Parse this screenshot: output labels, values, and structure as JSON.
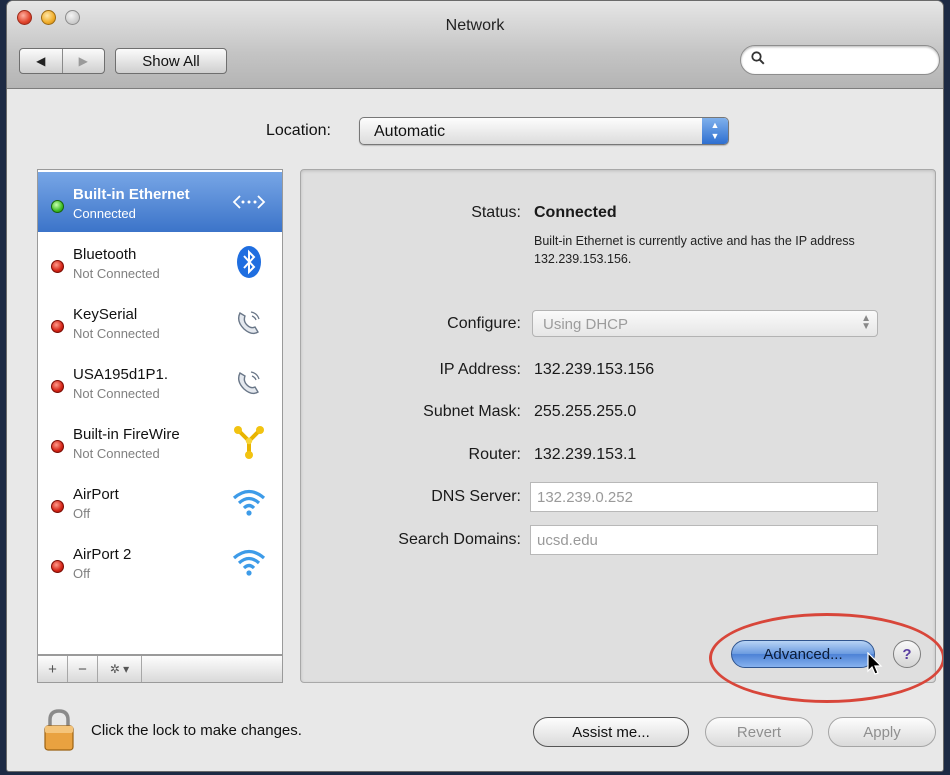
{
  "window": {
    "title": "Network"
  },
  "toolbar": {
    "back_icon": "◀",
    "forward_icon": "▶",
    "show_all_label": "Show All",
    "search_value": ""
  },
  "location": {
    "label": "Location:",
    "value": "Automatic"
  },
  "services": [
    {
      "name": "Built-in Ethernet",
      "status": "Connected",
      "icon": "ethernet-icon",
      "state": "connected",
      "selected": true
    },
    {
      "name": "Bluetooth",
      "status": "Not Connected",
      "icon": "bluetooth-icon",
      "state": "not-connected",
      "selected": false
    },
    {
      "name": "KeySerial",
      "status": "Not Connected",
      "icon": "modem-phone-icon",
      "state": "not-connected",
      "selected": false
    },
    {
      "name": "USA195d1P1.",
      "status": "Not Connected",
      "icon": "modem-phone-icon",
      "state": "not-connected",
      "selected": false
    },
    {
      "name": "Built-in FireWire",
      "status": "Not Connected",
      "icon": "firewire-icon",
      "state": "not-connected",
      "selected": false
    },
    {
      "name": "AirPort",
      "status": "Off",
      "icon": "wifi-icon",
      "state": "off",
      "selected": false
    },
    {
      "name": "AirPort 2",
      "status": "Off",
      "icon": "wifi-icon",
      "state": "off",
      "selected": false
    }
  ],
  "sidebar_controls": {
    "add": "+",
    "remove": "−",
    "action": "✲ ▾"
  },
  "detail": {
    "status_label": "Status:",
    "status_value": "Connected",
    "status_description": "Built-in Ethernet is currently active and has the IP address 132.239.153.156.",
    "configure_label": "Configure:",
    "configure_value": "Using DHCP",
    "ip_label": "IP Address:",
    "ip_value": "132.239.153.156",
    "subnet_label": "Subnet Mask:",
    "subnet_value": "255.255.255.0",
    "router_label": "Router:",
    "router_value": "132.239.153.1",
    "dns_label": "DNS Server:",
    "dns_placeholder": "132.239.0.252",
    "search_domains_label": "Search Domains:",
    "search_domains_placeholder": "ucsd.edu",
    "advanced_label": "Advanced...",
    "help_label": "?"
  },
  "footer": {
    "lock_text": "Click the lock to make changes.",
    "assist_label": "Assist me...",
    "revert_label": "Revert",
    "apply_label": "Apply"
  },
  "colors": {
    "selection_blue": "#3c74c9",
    "status_green": "#3fbe26",
    "status_red": "#d42416",
    "highlight_ring": "#d8463a"
  }
}
